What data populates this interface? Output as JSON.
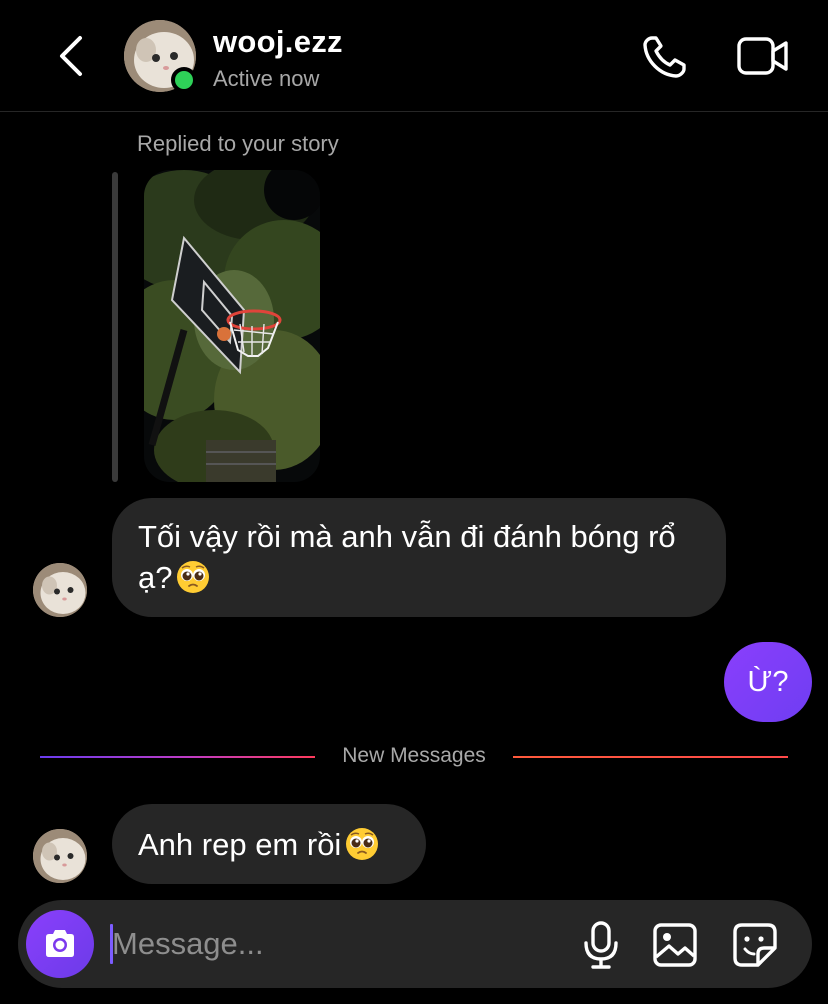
{
  "header": {
    "username": "wooj.ezz",
    "status": "Active now"
  },
  "story_reply": {
    "label": "Replied to your story"
  },
  "messages": [
    {
      "from": "them",
      "text": "Tối vậy rồi mà anh vẫn đi đánh bóng rổ ạ?",
      "emoji": "pleading-face"
    },
    {
      "from": "me",
      "text": "Ừ?"
    },
    {
      "from": "them",
      "text": "Anh rep em rồi",
      "emoji": "pleading-face"
    }
  ],
  "divider": {
    "label": "New Messages"
  },
  "composer": {
    "placeholder": "Message..."
  },
  "colors": {
    "accent": "#7c3aed",
    "online": "#2ed158",
    "bubble_incoming": "#262626"
  }
}
